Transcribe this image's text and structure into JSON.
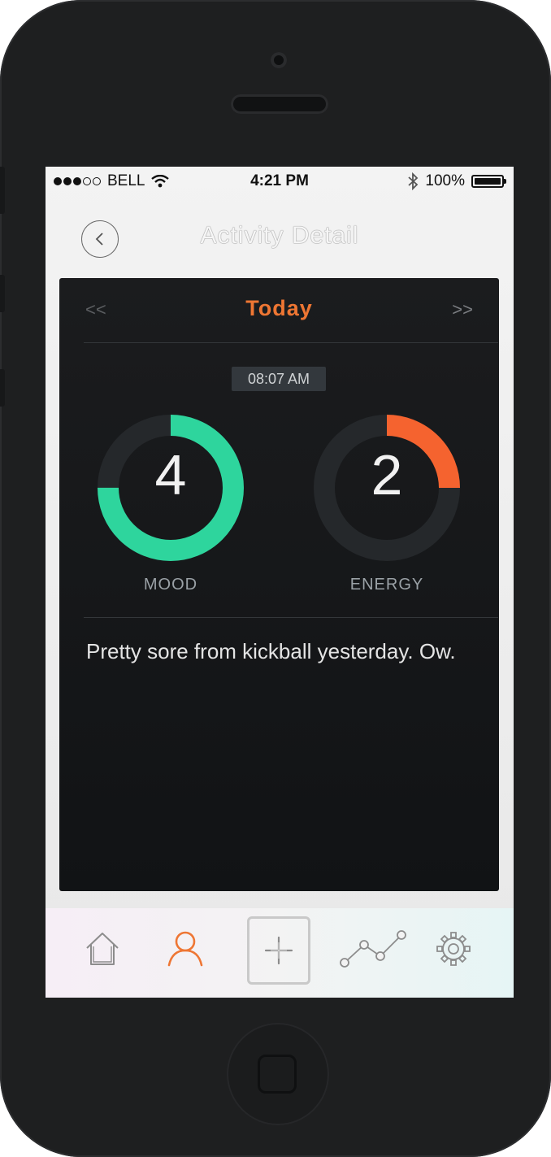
{
  "status_bar": {
    "carrier": "BELL",
    "time": "4:21 PM",
    "battery": "100%"
  },
  "navbar": {
    "title": "Activity Detail"
  },
  "entry": {
    "date_label": "Today",
    "prev_symbol": "<<",
    "next_symbol": ">>",
    "time": "08:07 AM",
    "mood": {
      "label": "MOOD",
      "value": "4",
      "level": 0.75,
      "color": "#2ed59d"
    },
    "energy": {
      "label": "ENERGY",
      "value": "2",
      "level": 0.25,
      "color": "#f5632f"
    },
    "note": "Pretty sore from kickball yesterday. Ow."
  },
  "colors": {
    "accent": "#ee7633",
    "card": "#131517",
    "ring_track": "#25282b"
  },
  "tab_bar": {
    "items": [
      "home-icon",
      "profile-icon",
      "add-icon",
      "trends-icon",
      "settings-icon"
    ],
    "active": "profile-icon"
  }
}
